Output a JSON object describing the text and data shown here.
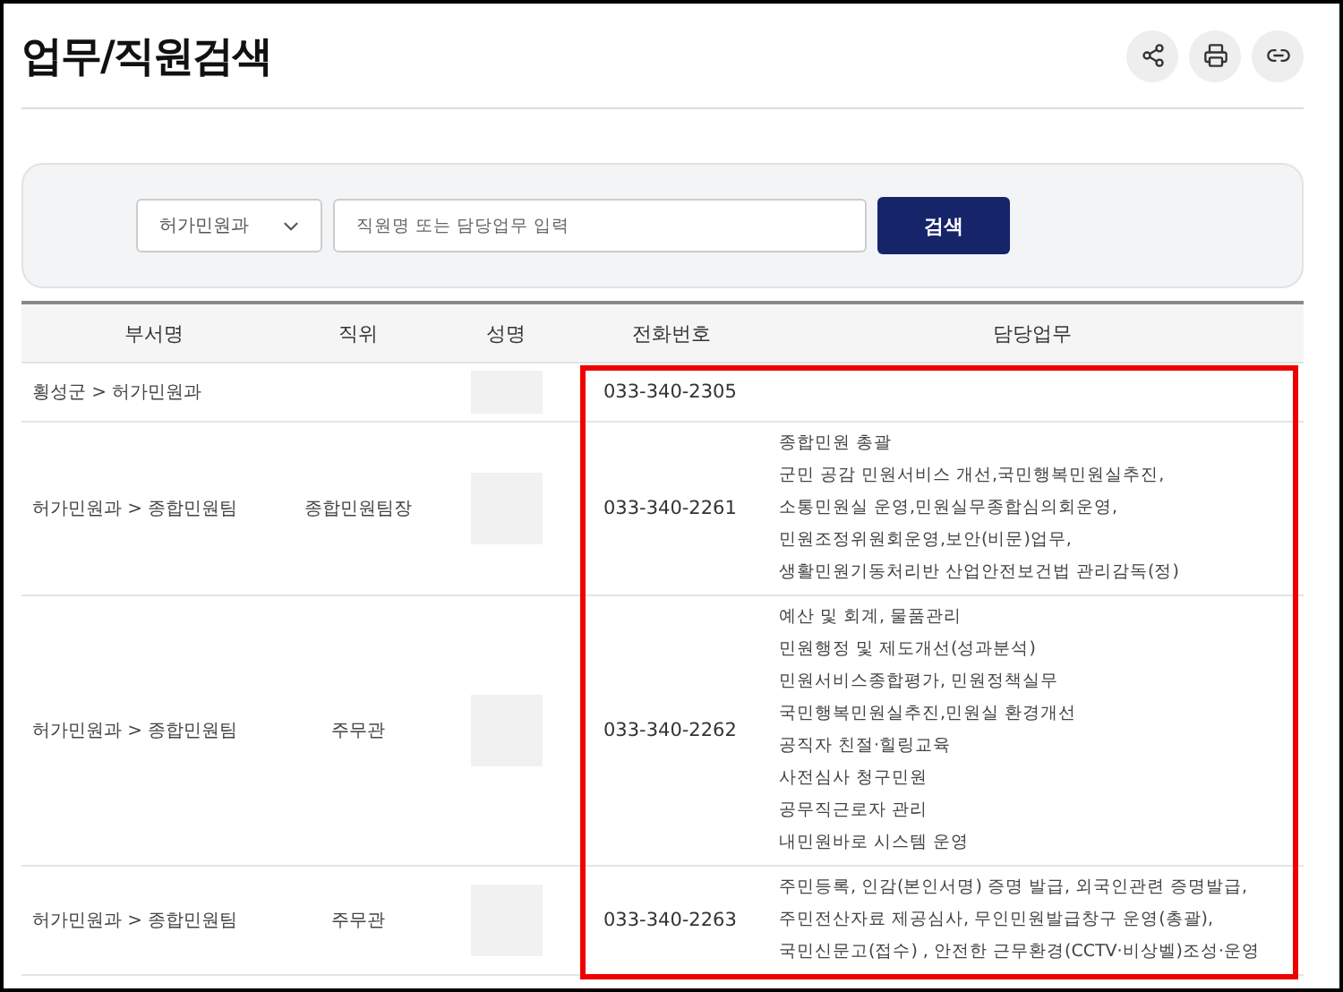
{
  "title": "업무/직원검색",
  "search": {
    "department": "허가민원과",
    "placeholder": "직원명 또는 담당업무 입력",
    "button": "검색"
  },
  "table": {
    "columns": [
      "부서명",
      "직위",
      "성명",
      "전화번호",
      "담당업무"
    ],
    "rows": [
      {
        "department": "횡성군 > 허가민원과",
        "phone": "033-340-2305"
      },
      {
        "department": "허가민원과 > 종합민원팀",
        "position": "종합민원팀장",
        "phone": "033-340-2261",
        "duties": [
          "종합민원 총괄",
          "군민 공감 민원서비스 개선,국민행복민원실추진,",
          "소통민원실 운영,민원실무종합심의회운영,",
          "민원조정위원회운영,보안(비문)업무,",
          "생활민원기동처리반 산업안전보건법 관리감독(정)"
        ]
      },
      {
        "department": "허가민원과 > 종합민원팀",
        "position": "주무관",
        "phone": "033-340-2262",
        "duties": [
          "예산 및 회계, 물품관리",
          "민원행정 및 제도개선(성과분석)",
          "민원서비스종합평가, 민원정책실무",
          "국민행복민원실추진,민원실 환경개선",
          "공직자 친절·힐링교육",
          "사전심사 청구민원",
          "공무직근로자 관리",
          "내민원바로 시스템 운영"
        ]
      },
      {
        "department": "허가민원과 > 종합민원팀",
        "position": "주무관",
        "phone": "033-340-2263",
        "duties": [
          "주민등록, 인감(본인서명) 증명 발급, 외국인관련 증명발급,",
          "주민전산자료 제공심사, 무인민원발급창구 운영(총괄),",
          "국민신문고(접수) , 안전한 근무환경(CCTV·비상벨)조성·운영"
        ]
      }
    ]
  }
}
